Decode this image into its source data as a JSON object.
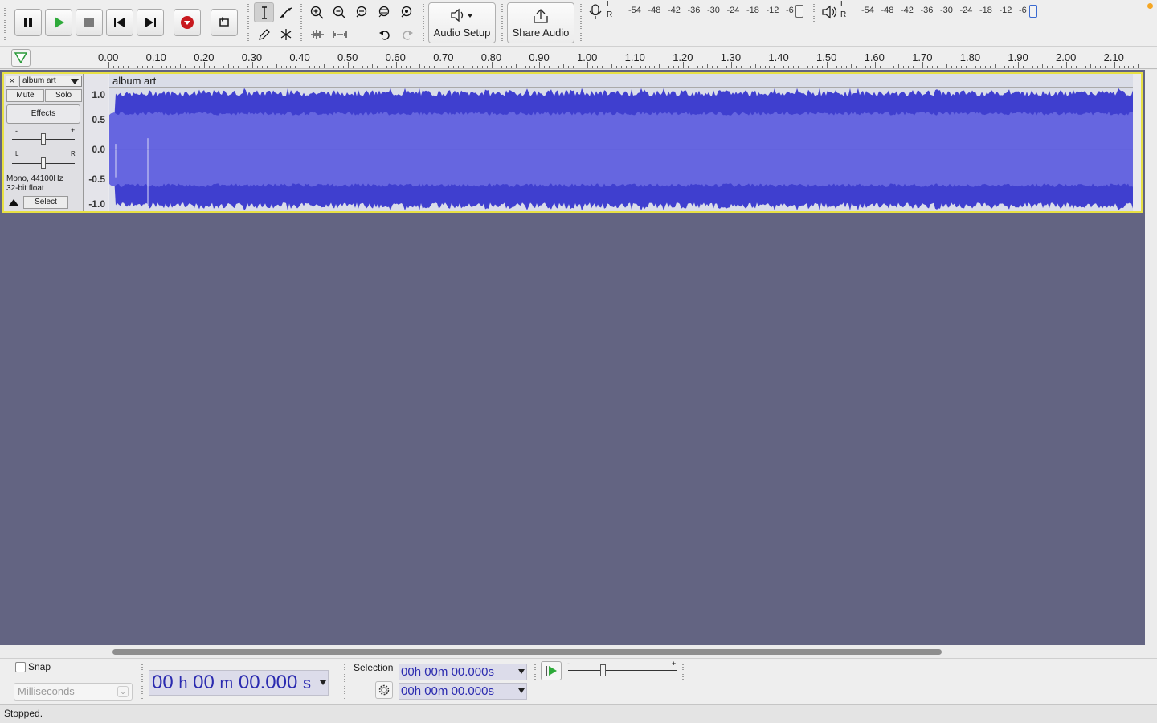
{
  "toolbar": {
    "transport": [
      "pause-button",
      "play-button",
      "stop-button",
      "skip-start-button",
      "skip-end-button",
      "record-button",
      "loop-button"
    ],
    "audio_setup_label": "Audio Setup",
    "share_audio_label": "Share Audio",
    "record_meter_scale": [
      "-54",
      "-48",
      "-42",
      "-36",
      "-30",
      "-24",
      "-18",
      "-12",
      "-6"
    ],
    "play_meter_scale": [
      "-54",
      "-48",
      "-42",
      "-36",
      "-30",
      "-24",
      "-18",
      "-12",
      "-6"
    ],
    "meter_channels": [
      "L",
      "R"
    ]
  },
  "ruler": {
    "ticks": [
      "0.00",
      "0.10",
      "0.20",
      "0.30",
      "0.40",
      "0.50",
      "0.60",
      "0.70",
      "0.80",
      "0.90",
      "1.00",
      "1.10",
      "1.20",
      "1.30",
      "1.40",
      "1.50",
      "1.60",
      "1.70",
      "1.80",
      "1.90",
      "2.00",
      "2.10"
    ]
  },
  "track": {
    "name": "album art",
    "clip_name": "album art",
    "mute_label": "Mute",
    "solo_label": "Solo",
    "effects_label": "Effects",
    "gain_minus": "-",
    "gain_plus": "+",
    "pan_left": "L",
    "pan_right": "R",
    "info_line1": "Mono, 44100Hz",
    "info_line2": "32-bit float",
    "select_label": "Select",
    "close_label": "×",
    "vruler": [
      "1.0",
      "0.5",
      "0.0",
      "-0.5",
      "-1.0"
    ],
    "waveform_color": "#6666e0"
  },
  "selection_bar": {
    "snap_label": "Snap",
    "snap_unit": "Milliseconds",
    "snap_checked": false,
    "time_main": {
      "h": "00",
      "m": "00",
      "s": "00.000"
    },
    "selection_label": "Selection",
    "sel_start": {
      "h": "00",
      "m": "00",
      "s": "00.000"
    },
    "sel_end": {
      "h": "00",
      "m": "00",
      "s": "00.000"
    },
    "unit_h": "h",
    "unit_m": "m",
    "unit_s": "s",
    "speed_minus": "-",
    "speed_plus": "+"
  },
  "status": {
    "text": "Stopped."
  }
}
